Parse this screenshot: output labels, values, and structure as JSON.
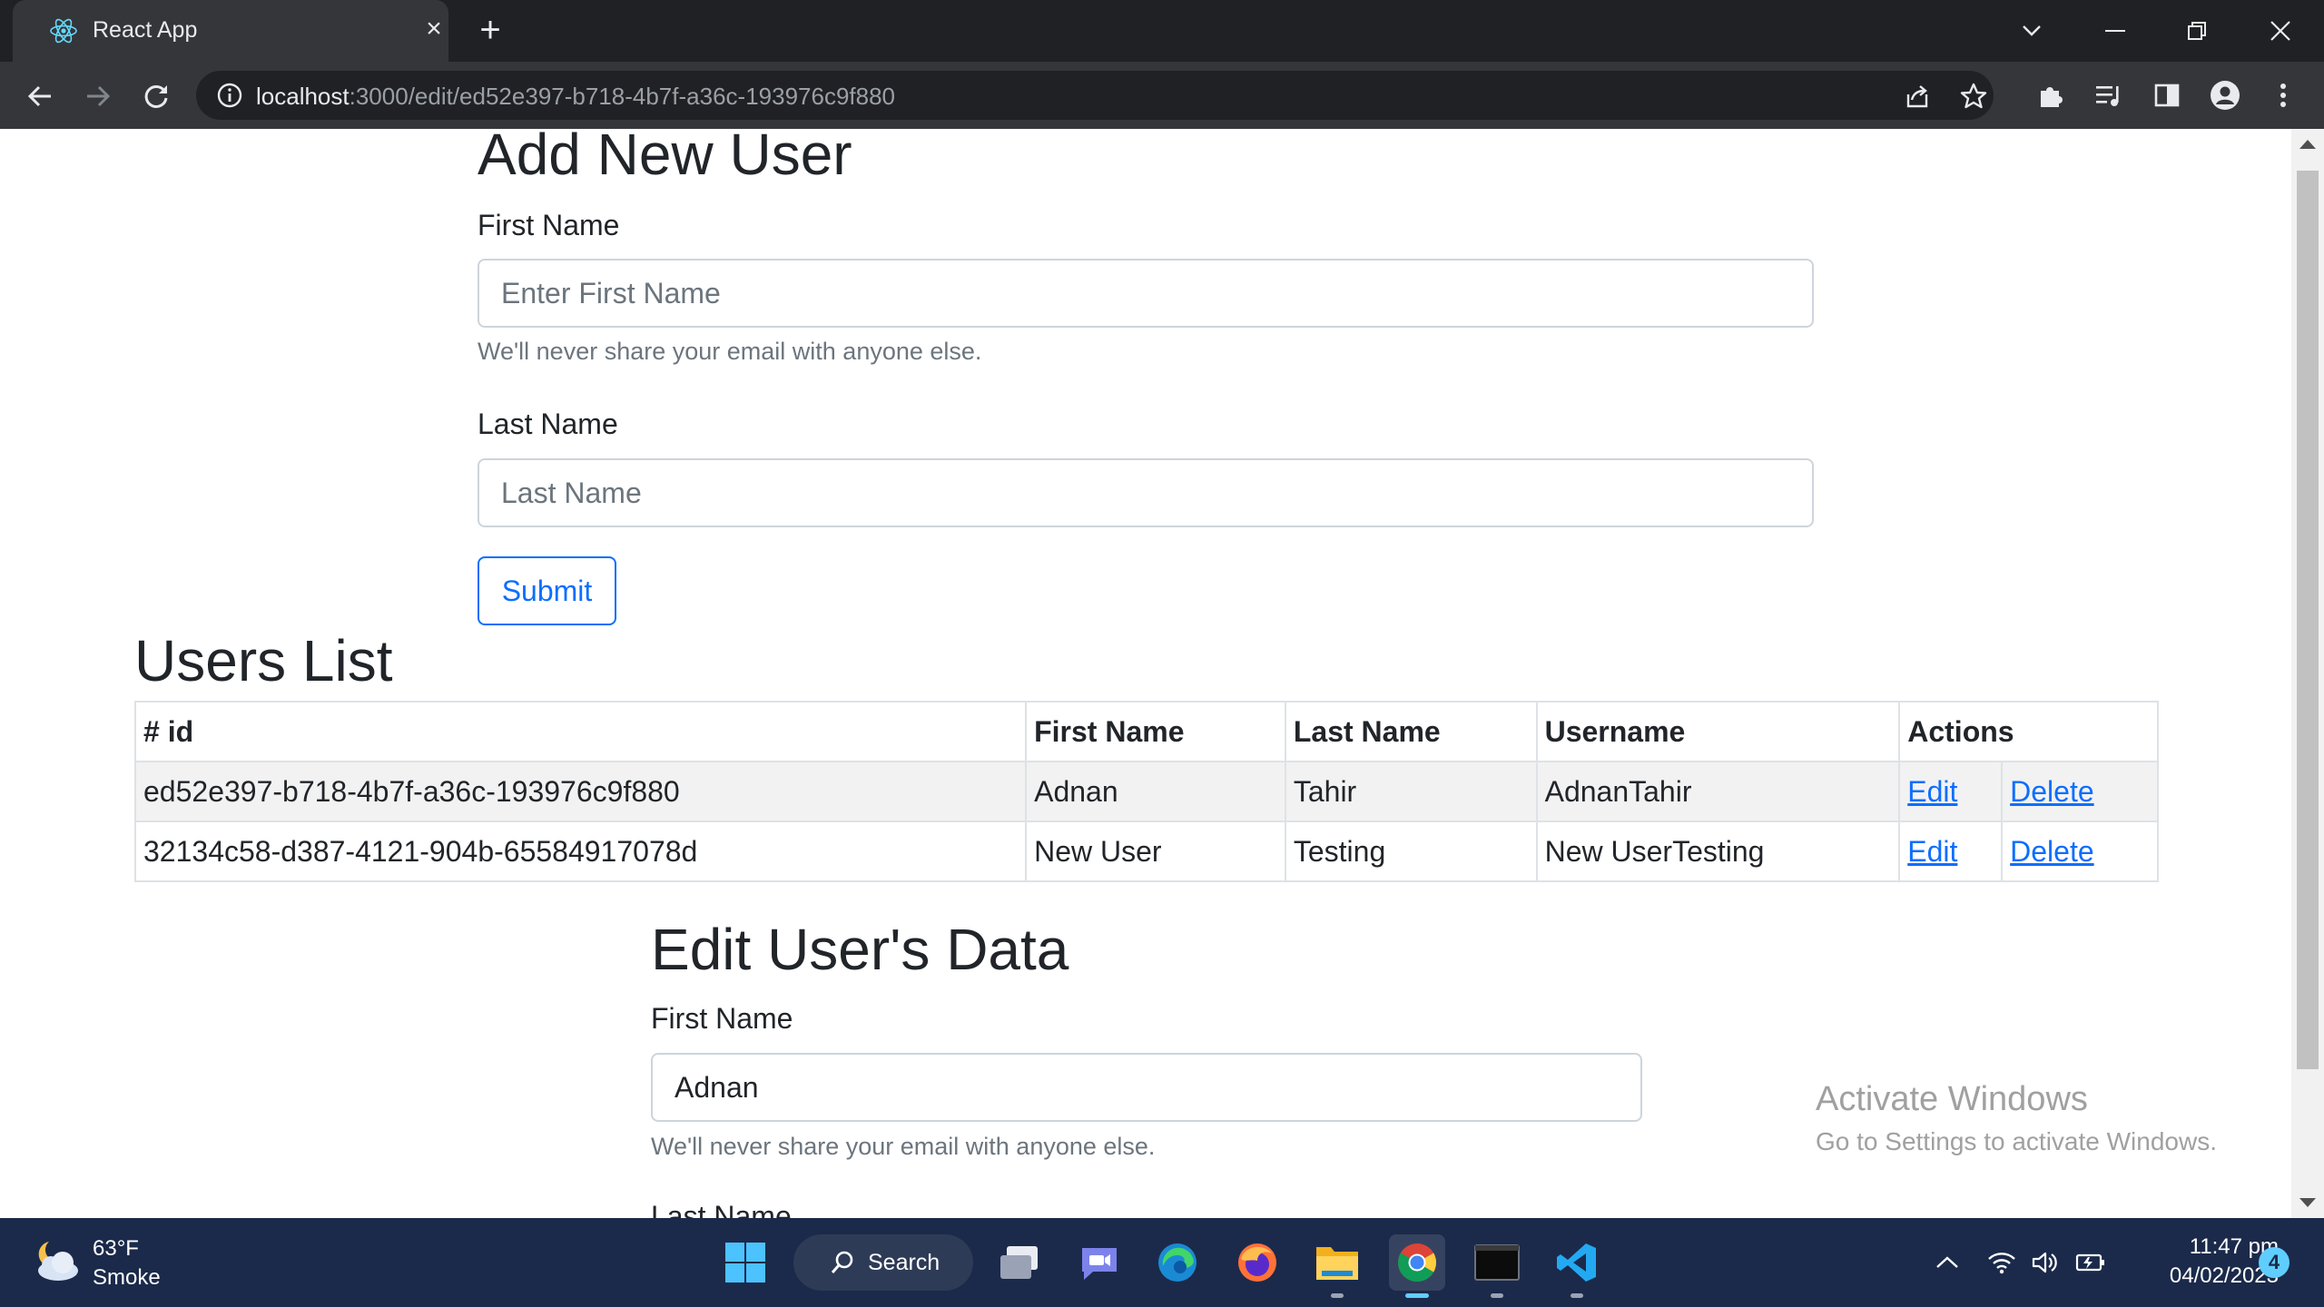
{
  "browser": {
    "tab_title": "React App",
    "url_host": "localhost",
    "url_rest": ":3000/edit/ed52e397-b718-4b7f-a36c-193976c9f880"
  },
  "add_form": {
    "heading": "Add New User",
    "first_name_label": "First Name",
    "first_name_placeholder": "Enter First Name",
    "help_text": "We'll never share your email with anyone else.",
    "last_name_label": "Last Name",
    "last_name_placeholder": "Last Name",
    "submit_label": "Submit"
  },
  "users_list": {
    "heading": "Users List",
    "columns": [
      "# id",
      "First Name",
      "Last Name",
      "Username",
      "Actions"
    ],
    "rows": [
      {
        "id": "ed52e397-b718-4b7f-a36c-193976c9f880",
        "first_name": "Adnan",
        "last_name": "Tahir",
        "username": "AdnanTahir",
        "edit": "Edit",
        "delete": "Delete"
      },
      {
        "id": "32134c58-d387-4121-904b-65584917078d",
        "first_name": "New User",
        "last_name": "Testing",
        "username": "New UserTesting",
        "edit": "Edit",
        "delete": "Delete"
      }
    ]
  },
  "edit_form": {
    "heading": "Edit User's Data",
    "first_name_label": "First Name",
    "first_name_value": "Adnan",
    "help_text": "We'll never share your email with anyone else.",
    "last_name_label": "Last Name"
  },
  "watermark": {
    "title": "Activate Windows",
    "subtitle": "Go to Settings to activate Windows."
  },
  "taskbar": {
    "weather_temp": "63°F",
    "weather_desc": "Smoke",
    "search_label": "Search",
    "time": "11:47 pm",
    "date": "04/02/2023",
    "notification_count": "4"
  },
  "colors": {
    "accent": "#0d6efd",
    "chrome_dark": "#202124",
    "chrome_toolbar": "#35363a",
    "taskbar": "#1b2a4a"
  }
}
